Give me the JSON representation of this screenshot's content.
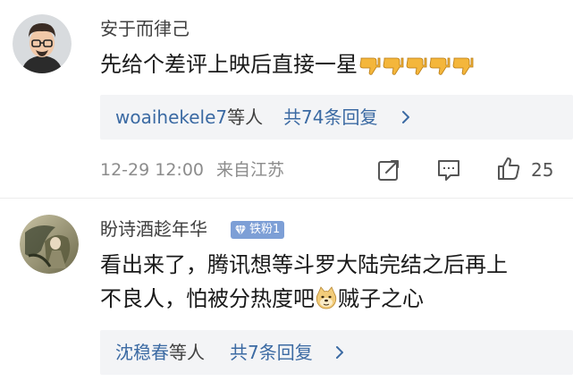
{
  "comments": [
    {
      "username": "安于而律己",
      "text": "先给个差评上映后直接一星",
      "emojis": [
        "thumbs-down-emoji",
        "thumbs-down-emoji",
        "thumbs-down-emoji",
        "thumbs-down-emoji",
        "thumbs-down-emoji"
      ],
      "replies": {
        "users": "woaihekele7",
        "users_suffix": "等人",
        "count_label": "共74条回复"
      },
      "time": "12-29 12:00",
      "location": "来自江苏",
      "likes": "25",
      "icons": [
        "share-icon",
        "comment-icon",
        "like-icon"
      ]
    },
    {
      "username": "盼诗酒趁年华",
      "badge": "铁粉1",
      "badge_icon": "diamond-icon",
      "text_line1": "看出来了，腾讯想等斗罗大陆完结之后再上",
      "text_line2_before": "不良人，怕被分热度吧",
      "emoji": "doge-emoji",
      "text_line2_after": "贼子之心",
      "replies": {
        "users": "沈稳春",
        "users_suffix": "等人",
        "count_label": "共7条回复"
      }
    }
  ],
  "colors": {
    "link_blue": "#3b6aa3",
    "meta_gray": "#8c8c8c",
    "reply_bg": "#f3f4f6",
    "badge_blue": "#7d9fd6"
  }
}
